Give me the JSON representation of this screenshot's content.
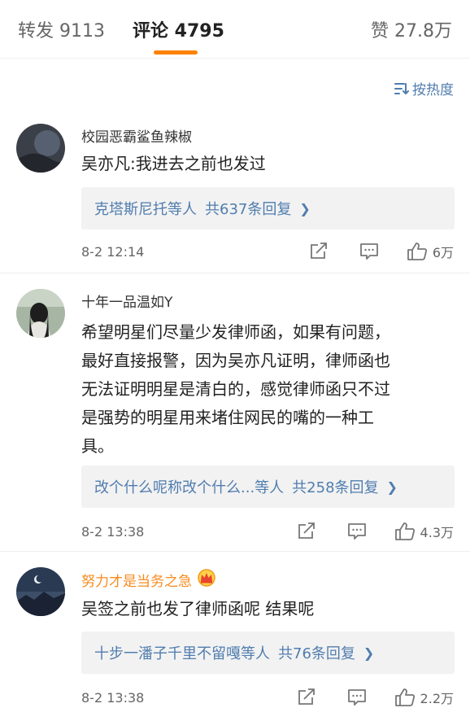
{
  "tabs": {
    "repost": "转发 9113",
    "comments": "评论 4795",
    "likes": "赞 27.8万"
  },
  "sort": {
    "label": "按热度",
    "icon": "sort-lines-icon"
  },
  "colors": {
    "accent": "#ff8200",
    "link": "#507daf",
    "vip_name": "#f78b1f"
  },
  "comments": [
    {
      "username": "校园恶霸鲨鱼辣椒",
      "text": "吴亦凡:我进去之前也发过",
      "reply_people": "克塔斯尼托等人",
      "reply_count": "共637条回复",
      "time": "8-2 12:14",
      "likes": "6万"
    },
    {
      "username": "十年一品温如Y",
      "text_lines": [
        "希望明星们尽量少发律师函，如果有问题，",
        "最好直接报警，因为吴亦凡证明，律师函也",
        "无法证明明星是清白的，感觉律师函只不过",
        "是强势的明星用来堵住网民的嘴的一种工",
        "具。"
      ],
      "reply_people": "改个什么呢称改个什么...等人",
      "reply_count": "共258条回复",
      "time": "8-2 13:38",
      "likes": "4.3万"
    },
    {
      "username": "努力才是当务之急",
      "badge_icon": "crown-badge-icon",
      "text": "吴签之前也发了律师函呢 结果呢",
      "reply_people": "十步一潘子千里不留嘎等人",
      "reply_count": "共76条回复",
      "time": "8-2 13:38",
      "likes": "2.2万"
    }
  ]
}
